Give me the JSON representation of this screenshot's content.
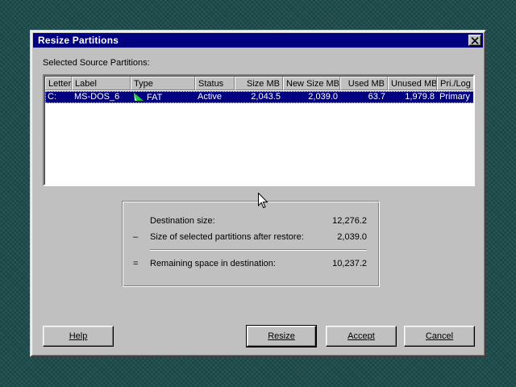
{
  "dialog": {
    "title": "Resize Partitions",
    "close_icon": "close-icon",
    "section_label": "Selected Source Partitions:"
  },
  "listview": {
    "columns": [
      "Letter",
      "Label",
      "Type",
      "Status",
      "Size MB",
      "New Size MB",
      "Used MB",
      "Unused MB",
      "Pri./Log"
    ],
    "rows": [
      {
        "letter": "C:",
        "label": "MS-DOS_6",
        "type_icon": "fat-partition-icon",
        "type": "FAT",
        "status": "Active",
        "size_mb": "2,043.5",
        "new_size_mb": "2,039.0",
        "used_mb": "63.7",
        "unused_mb": "1,979.8",
        "pri_log": "Primary",
        "selected": true
      }
    ]
  },
  "summary": {
    "destination_label": "Destination size:",
    "destination_value": "12,276.2",
    "minus_op": "–",
    "after_restore_label": "Size of selected partitions after restore:",
    "after_restore_value": "2,039.0",
    "equals_op": "=",
    "remaining_label": "Remaining space in destination:",
    "remaining_value": "10,237.2"
  },
  "buttons": {
    "help": "Help",
    "resize": "Resize",
    "accept": "Accept",
    "cancel": "Cancel"
  },
  "colors": {
    "titlebar": "#000080",
    "selection": "#000080",
    "face": "#c0c0c0",
    "fat_icon": "#22cc44"
  }
}
